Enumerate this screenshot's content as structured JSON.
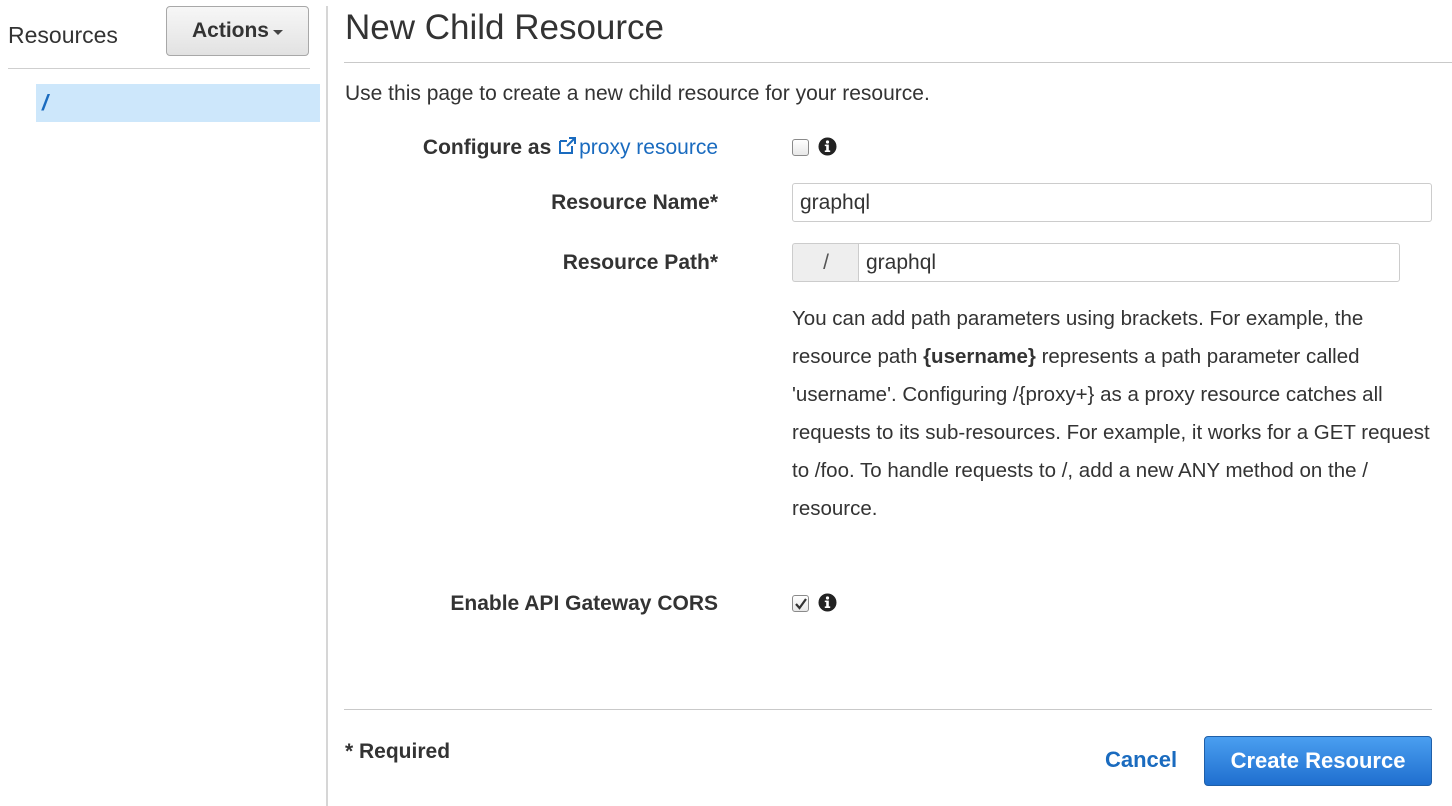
{
  "sidebar": {
    "title": "Resources",
    "actions_label": "Actions",
    "tree": [
      {
        "label": "/"
      }
    ]
  },
  "main": {
    "title": "New Child Resource",
    "intro": "Use this page to create a new child resource for your resource.",
    "proxy": {
      "label_prefix": "Configure as ",
      "link_text": "proxy resource",
      "checked": false
    },
    "resource_name": {
      "label": "Resource Name*",
      "value": "graphql"
    },
    "resource_path": {
      "label": "Resource Path*",
      "prefix": "/",
      "value": "graphql"
    },
    "help": {
      "part1": "You can add path parameters using brackets. For example, the resource path ",
      "bold": "{username}",
      "part2": " represents a path parameter called 'username'. Configuring /{proxy+} as a proxy resource catches all requests to its sub-resources. For example, it works for a GET request to /foo. To handle requests to /, add a new ANY method on the / resource."
    },
    "cors": {
      "label": "Enable API Gateway CORS",
      "checked": true
    },
    "footer": {
      "required": "* Required",
      "cancel": "Cancel",
      "create": "Create Resource"
    }
  },
  "colors": {
    "link": "#1a6bbf",
    "selected_bg": "#cde7fb",
    "primary_button": "#1f6fcf"
  },
  "icons": [
    "external-link-icon",
    "info-icon",
    "checkmark-icon",
    "caret-down-icon"
  ]
}
